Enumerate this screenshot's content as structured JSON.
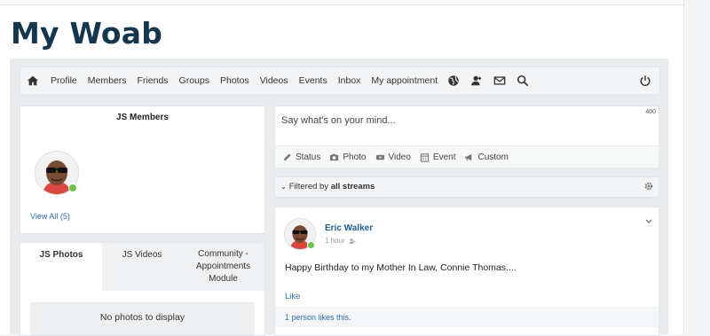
{
  "site": {
    "title": "My Woab"
  },
  "nav": {
    "items": [
      "Profile",
      "Members",
      "Friends",
      "Groups",
      "Photos",
      "Videos",
      "Events",
      "Inbox",
      "My appointment"
    ],
    "icons": [
      "home-icon",
      "globe-icon",
      "user-add-icon",
      "mail-icon",
      "search-icon",
      "power-icon"
    ]
  },
  "members": {
    "title": "JS Members",
    "view_all": "View All (5)"
  },
  "tabs": {
    "items": [
      "JS Photos",
      "JS Videos",
      "Community - Appointments Module"
    ],
    "empty": "No photos to display"
  },
  "status": {
    "placeholder": "Say what's on your mind...",
    "char_count": "400",
    "actions": [
      "Status",
      "Photo",
      "Video",
      "Event",
      "Custom"
    ]
  },
  "filter": {
    "prefix": "Filtered by ",
    "value": "all streams"
  },
  "post": {
    "author": "Eric Walker",
    "time": "1 hour",
    "text": "Happy Birthday to my Mother In Law, Connie Thomas....",
    "like": "Like",
    "likes_count": "1 person likes this."
  },
  "colors": {
    "title": "#15364f",
    "link": "#2a6fb0",
    "online": "#6cc24a"
  }
}
